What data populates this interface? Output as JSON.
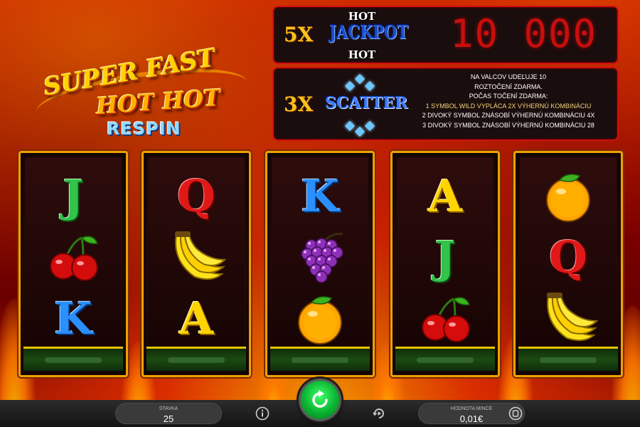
{
  "game": {
    "logo": {
      "line1": "SUPER FAST",
      "line2": "HOT HOT",
      "line3": "RESPIN"
    }
  },
  "jackpot_panel": {
    "multiplier": "5X",
    "emblem_top": "HOT",
    "emblem_word": "JACKPOT",
    "emblem_bottom": "HOT",
    "amount": "10 000"
  },
  "scatter_panel": {
    "multiplier": "3X",
    "emblem_word": "SCATTER",
    "lines": [
      "NA VALCOV UDEĽUJE 10",
      "ROZTOČENÍ ZDARMA.",
      "POČAS TOČENÍ ZDARMA:",
      "1 SYMBOL WILD VYPLÁCA 2X VÝHERNÚ KOMBINÁCIU",
      "2 DIVOKÝ SYMBOL ZNÁSOBÍ VÝHERNÚ KOMBINÁCIU 4X",
      "3 DIVOKÝ SYMBOL ZNÁSOBÍ VÝHERNÚ KOMBINÁCIU 28"
    ]
  },
  "reels": [
    {
      "symbols": [
        {
          "type": "letter",
          "value": "J"
        },
        {
          "type": "cherry"
        },
        {
          "type": "letter",
          "value": "K"
        }
      ]
    },
    {
      "symbols": [
        {
          "type": "letter",
          "value": "Q"
        },
        {
          "type": "banana"
        },
        {
          "type": "letter",
          "value": "A"
        }
      ]
    },
    {
      "symbols": [
        {
          "type": "letter",
          "value": "K"
        },
        {
          "type": "grapes"
        },
        {
          "type": "orange"
        }
      ]
    },
    {
      "symbols": [
        {
          "type": "letter",
          "value": "A"
        },
        {
          "type": "letter",
          "value": "J"
        },
        {
          "type": "cherry"
        }
      ]
    },
    {
      "symbols": [
        {
          "type": "orange"
        },
        {
          "type": "letter",
          "value": "Q"
        },
        {
          "type": "banana"
        }
      ]
    }
  ],
  "bottom_bar": {
    "bet_label": "STAVKA",
    "bet_value": "25",
    "coin_label": "HODNOTA MINCE",
    "coin_value": "0,01€",
    "icons": [
      "info-icon",
      "autoplay-icon",
      "spin-icon",
      "settings-icon"
    ]
  },
  "colors": {
    "panel_border": "#d10f0f",
    "jackpot_digits": "#c80e0e",
    "multiplier": "#ffbf1a",
    "reel_frame": "#f0a000",
    "spin_button": "#0bb432"
  }
}
